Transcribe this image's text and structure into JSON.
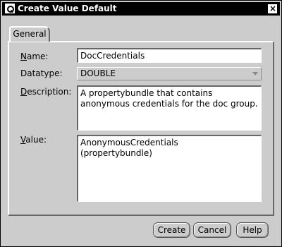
{
  "window": {
    "title": "Create Value Default",
    "close_glyph": "×"
  },
  "tabs": [
    {
      "label": "General",
      "active": true
    }
  ],
  "form": {
    "name": {
      "label_mnemonic": "N",
      "label_rest": "ame:",
      "value": "DocCredentials"
    },
    "datatype": {
      "label_rest": "Datatype:",
      "value": "DOUBLE"
    },
    "description": {
      "label_mnemonic": "D",
      "label_rest": "escription:",
      "value": "A propertybundle that contains anonymous credentials for the doc group."
    },
    "value_field": {
      "label_mnemonic": "V",
      "label_rest": "alue:",
      "value": "AnonymousCredentials\n(propertybundle)"
    }
  },
  "buttons": {
    "create": "Create",
    "cancel": "Cancel",
    "help": "Help"
  }
}
